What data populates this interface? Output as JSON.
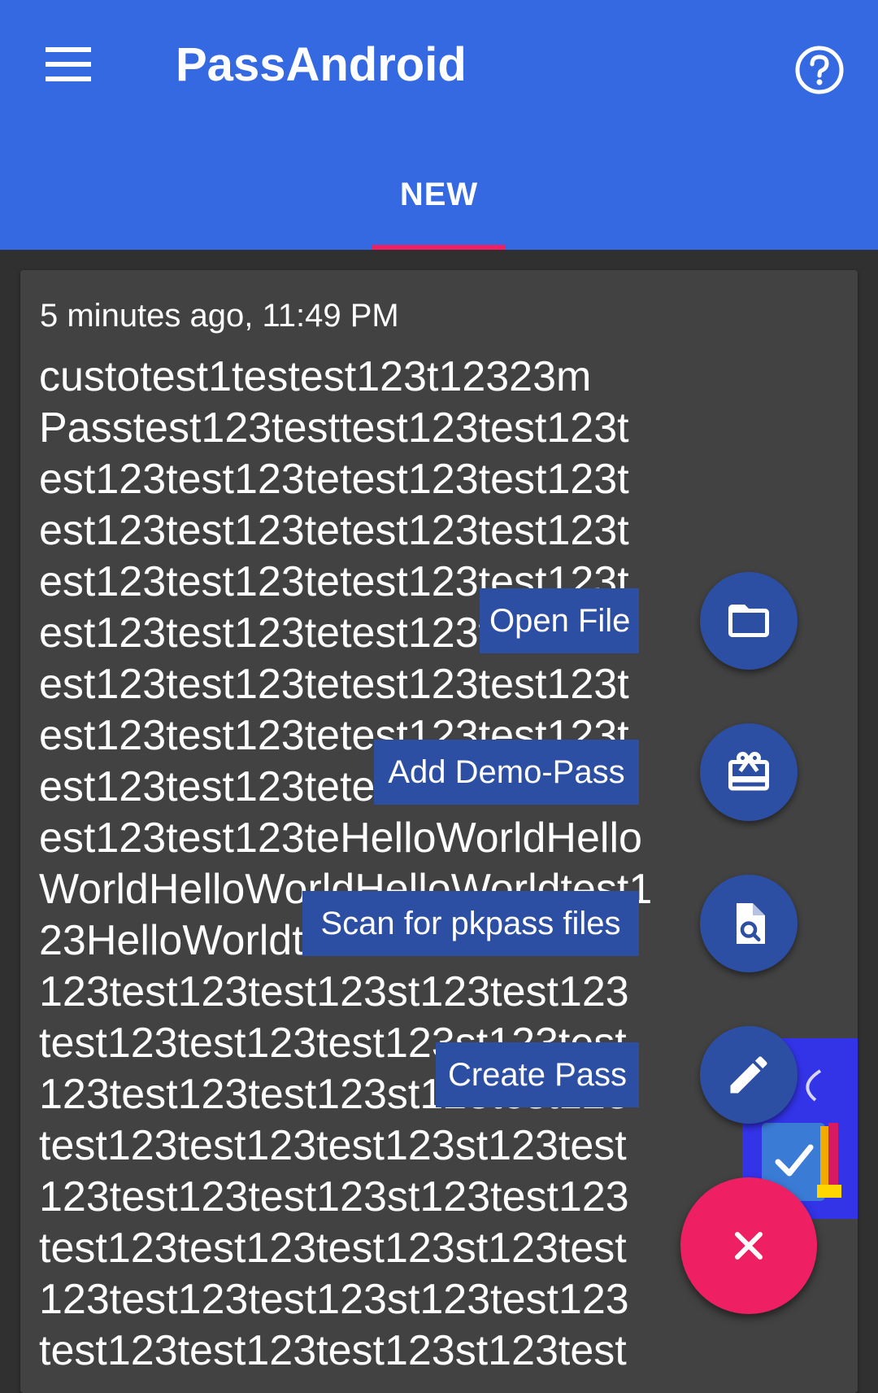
{
  "app_bar": {
    "title": "PassAndroid",
    "menu_icon": "menu-icon",
    "help_icon": "help-circle-icon",
    "color": "#3569e1"
  },
  "tabs": [
    {
      "label": "NEW",
      "selected": true,
      "indicator_color": "#ee1f63"
    }
  ],
  "pass_card": {
    "time": "5 minutes ago, 11:49 PM",
    "description_lines": [
      "custotest1testest123t12323m",
      "Passtest123testtest123test123t",
      "est123test123tetest123test123t",
      "est123test123tetest123test123t",
      "est123test123tetest123test123t",
      "est123test123tetest123test123t",
      "est123test123tetest123test123t",
      "est123test123tetest123test123t",
      "est123test123tetest123test123t",
      "est123test123teHelloWorldHello",
      "WorldHelloWorldHelloWorldtest1",
      "23HelloWorldtest123test123test",
      "123test123test123st123test123",
      "test123test123test123st123test",
      "123test123test123st123test123",
      "test123test123test123st123test",
      "123test123test123st123test123",
      "test123test123test123st123test",
      "123test123test123st123test123",
      "test123test123test123st123test"
    ],
    "thumbnail": "pass-thumbnail-image"
  },
  "fab_menu": {
    "items": [
      {
        "label": "Open File",
        "icon": "folder-icon"
      },
      {
        "label": "Add Demo-Pass",
        "icon": "ticket-icon"
      },
      {
        "label": "Scan for pkpass files",
        "icon": "file-search-icon"
      },
      {
        "label": "Create Pass",
        "icon": "pencil-icon"
      }
    ],
    "item_color": "#2d4fa3",
    "close_icon": "close-icon",
    "close_color": "#ee1f63"
  }
}
